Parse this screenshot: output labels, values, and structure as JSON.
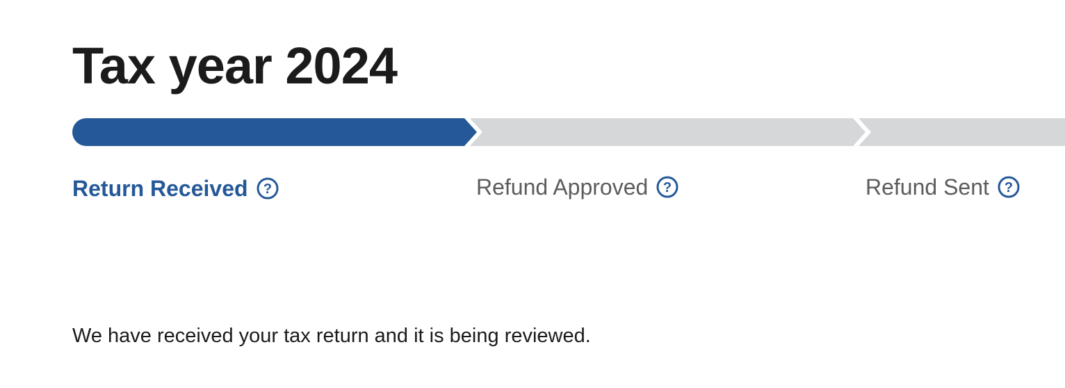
{
  "page_title": "Tax year 2024",
  "tracker": {
    "current_step": 1,
    "total_steps": 3,
    "colors": {
      "active": "#245897",
      "inactive": "#d6d7d9"
    },
    "steps": [
      {
        "label": "Return Received",
        "state": "active",
        "help_icon": "question-circle-icon"
      },
      {
        "label": "Refund Approved",
        "state": "inactive",
        "help_icon": "question-circle-icon"
      },
      {
        "label": "Refund Sent",
        "state": "inactive",
        "help_icon": "question-circle-icon"
      }
    ]
  },
  "status_message": "We have received your tax return and it is being reviewed."
}
